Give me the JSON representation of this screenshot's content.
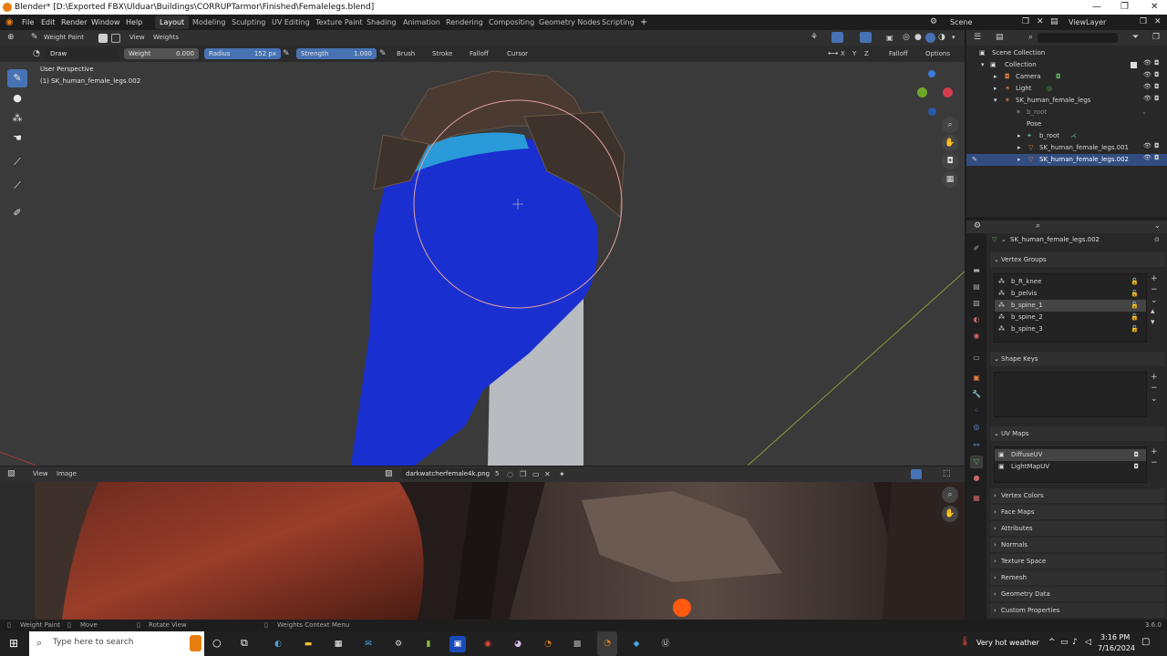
{
  "window": {
    "title": "Blender* [D:\\Exported FBX\\Ulduar\\Buildings\\CORRUPTarmor\\Finished\\Femalelegs.blend]"
  },
  "menu": {
    "file": "File",
    "edit": "Edit",
    "render": "Render",
    "window": "Window",
    "help": "Help"
  },
  "workspaces": [
    "Layout",
    "Modeling",
    "Sculpting",
    "UV Editing",
    "Texture Paint",
    "Shading",
    "Animation",
    "Rendering",
    "Compositing",
    "Geometry Nodes",
    "Scripting"
  ],
  "active_workspace": "Layout",
  "scene": {
    "name": "Scene",
    "view_layer": "ViewLayer"
  },
  "viewport_header": {
    "mode": "Weight Paint",
    "view": "View",
    "weights": "Weights"
  },
  "tool_settings": {
    "brush_name": "Draw",
    "weight_label": "Weight",
    "weight_value": "0.000",
    "radius_label": "Radius",
    "radius_value": "152 px",
    "strength_label": "Strength",
    "strength_value": "1.000",
    "brush": "Brush",
    "stroke": "Stroke",
    "falloff": "Falloff",
    "cursor": "Cursor",
    "falloff_right": "Falloff",
    "options": "Options"
  },
  "viewport": {
    "perspective": "User Perspective",
    "object": "(1) SK_human_female_legs.002"
  },
  "image_editor": {
    "view": "View",
    "image": "Image",
    "image_name": "darkwatcherfemale4k.png",
    "users": "5"
  },
  "outliner": {
    "search_placeholder": "",
    "rows": [
      {
        "label": "Scene Collection"
      },
      {
        "label": "Collection"
      },
      {
        "label": "Camera"
      },
      {
        "label": "Light"
      },
      {
        "label": "SK_human_female_legs"
      },
      {
        "label": "b_root"
      },
      {
        "label": "Pose"
      },
      {
        "label": "b_root"
      },
      {
        "label": "SK_human_female_legs.001"
      },
      {
        "label": "SK_human_female_legs.002"
      }
    ]
  },
  "properties": {
    "object_name": "SK_human_female_legs.002",
    "vertex_groups_title": "Vertex Groups",
    "vertex_groups": [
      "b_R_knee",
      "b_pelvis",
      "b_spine_1",
      "b_spine_2",
      "b_spine_3"
    ],
    "active_vertex_group": "b_spine_1",
    "shape_keys_title": "Shape Keys",
    "uv_maps_title": "UV Maps",
    "uv_maps": [
      "DiffuseUV",
      "LightMapUV"
    ],
    "panels": [
      "Vertex Colors",
      "Face Maps",
      "Attributes",
      "Normals",
      "Texture Space",
      "Remesh",
      "Geometry Data",
      "Custom Properties"
    ]
  },
  "statusbar": {
    "left": "Weight Paint",
    "move": "Move",
    "rotate": "Rotate View",
    "context": "Weights Context Menu",
    "version": "3.6.0"
  },
  "taskbar": {
    "search_placeholder": "Type here to search",
    "weather": "Very hot weather",
    "time": "3:16 PM",
    "date": "7/16/2024"
  },
  "colors": {
    "accent": "#4772b3",
    "selection": "#334d80",
    "brush_circle": "#e0a0a0",
    "mesh_blue": "#1a2fd0"
  }
}
